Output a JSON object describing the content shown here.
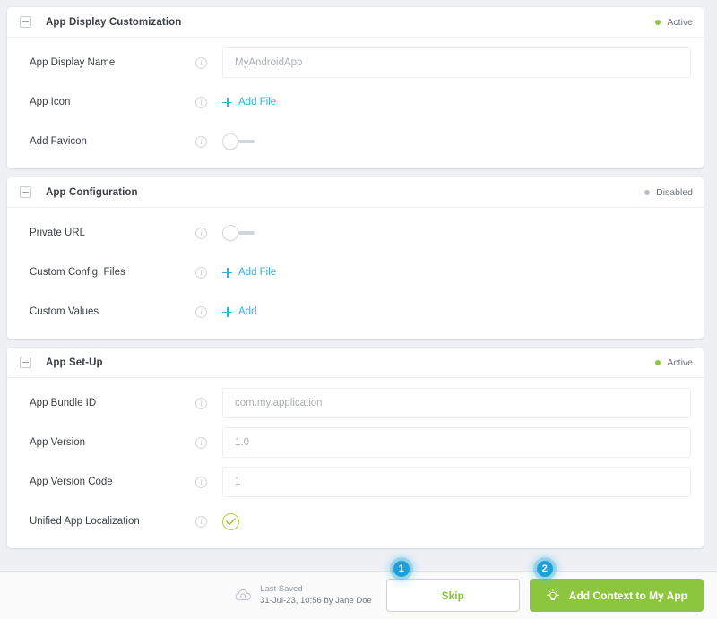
{
  "sections": [
    {
      "title": "App Display Customization",
      "status": {
        "label": "Active",
        "state": "active",
        "color": "#8cc63f"
      },
      "collapse_icon": "minus-square-icon",
      "rows": [
        {
          "label": "App Display Name",
          "info_icon": "info-icon",
          "control": "input",
          "placeholder": "MyAndroidApp",
          "value": ""
        },
        {
          "label": "App Icon",
          "info_icon": "info-icon",
          "control": "add-link",
          "link_label": "Add File"
        },
        {
          "label": "Add Favicon",
          "info_icon": "info-icon",
          "control": "toggle",
          "toggle_state": "off"
        }
      ]
    },
    {
      "title": "App Configuration",
      "status": {
        "label": "Disabled",
        "state": "disabled",
        "color": "#b9bdc3"
      },
      "collapse_icon": "minus-square-icon",
      "rows": [
        {
          "label": "Private URL",
          "info_icon": "info-icon",
          "control": "toggle",
          "toggle_state": "off"
        },
        {
          "label": "Custom Config. Files",
          "info_icon": "info-icon",
          "control": "add-link",
          "link_label": "Add File"
        },
        {
          "label": "Custom Values",
          "info_icon": "info-icon",
          "control": "add-link",
          "link_label": "Add"
        }
      ]
    },
    {
      "title": "App Set-Up",
      "status": {
        "label": "Active",
        "state": "active",
        "color": "#8cc63f"
      },
      "collapse_icon": "minus-square-icon",
      "rows": [
        {
          "label": "App Bundle ID",
          "info_icon": "info-icon",
          "control": "input",
          "placeholder": "com.my.application",
          "value": ""
        },
        {
          "label": "App Version",
          "info_icon": "info-icon",
          "control": "input",
          "placeholder": "1.0",
          "value": ""
        },
        {
          "label": "App Version Code",
          "info_icon": "info-icon",
          "control": "input",
          "placeholder": "1",
          "value": ""
        },
        {
          "label": "Unified App Localization",
          "info_icon": "info-icon",
          "control": "check",
          "checked": true,
          "check_color": "#b2cf4b"
        }
      ]
    }
  ],
  "footer": {
    "cloud_icon": "cloud-save-icon",
    "last_saved_title": "Last Saved",
    "last_saved_meta": "31-Jul-23, 10:56 by Jane Doe",
    "skip_button": {
      "label": "Skip",
      "step": "1"
    },
    "primary_button": {
      "label": "Add Context to My App",
      "step": "2",
      "icon": "lightbulb-icon"
    }
  },
  "theme": {
    "page_bg": "#eef0f4",
    "accent_green": "#8cc63f",
    "accent_blue": "#35aee2",
    "badge_blue": "#1fa0da"
  }
}
